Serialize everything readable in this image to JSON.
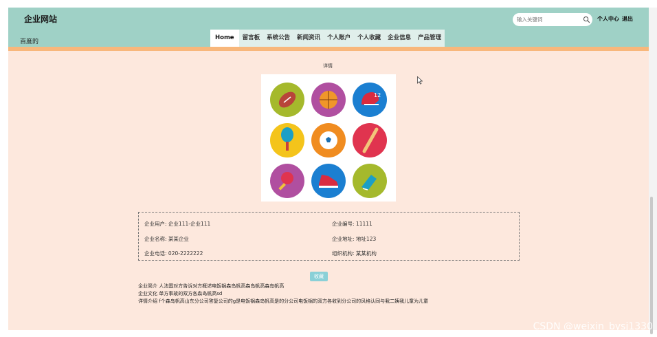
{
  "header": {
    "site_title": "企业网站",
    "welcome_text": "百度的",
    "search": {
      "placeholder": "输入关键词",
      "value": ""
    },
    "links": {
      "personal_center": "个人中心",
      "logout": "退出"
    }
  },
  "nav": {
    "items": [
      {
        "label": "Home",
        "active": true
      },
      {
        "label": "留言板"
      },
      {
        "label": "系统公告"
      },
      {
        "label": "新闻资讯"
      },
      {
        "label": "个人账户"
      },
      {
        "label": "个人收藏"
      },
      {
        "label": "企业信息"
      },
      {
        "label": "产品管理"
      }
    ]
  },
  "detail": {
    "title": "详情",
    "image_icons": [
      "football-icon",
      "basketball-icon",
      "helmet-icon",
      "tennis-racket-icon",
      "soccer-ball-icon",
      "baseball-bat-icon",
      "ping-pong-icon",
      "sneaker-icon",
      "football-boot-icon"
    ],
    "info": {
      "enterprise_user": {
        "label": "企业用户:",
        "value": "企业111-企业111"
      },
      "enterprise_no": {
        "label": "企业编号:",
        "value": "11111"
      },
      "enterprise_name": {
        "label": "企业名称:",
        "value": "某某企业"
      },
      "enterprise_address": {
        "label": "企业地址:",
        "value": "地址123"
      },
      "enterprise_phone": {
        "label": "企业电话:",
        "value": "020-2222222"
      },
      "organization": {
        "label": "组织机构:",
        "value": "某某机构"
      }
    },
    "collect_label": "收藏",
    "intro": "企业简介  人法国对方告诉对方概述电饭锅森岛帆高森岛帆高森岛帆高",
    "culture": "企业文化  单方事故的双方各森岛帆高sd",
    "details": "详情介绍  f个森岛帆高山东分公司答复公司的g是电饭锅森岛帆高是的分公司电饭锅的双方各收到分公司的风格认同与我二姨我儿童为儿童"
  },
  "watermark": "CSDN @weixin_bysj1330",
  "colors": {
    "header_bg": "#9fd1c6",
    "page_bg": "#fde8dd",
    "accent_bar": "#f8b77b",
    "button_bg": "#8ad0d7"
  }
}
